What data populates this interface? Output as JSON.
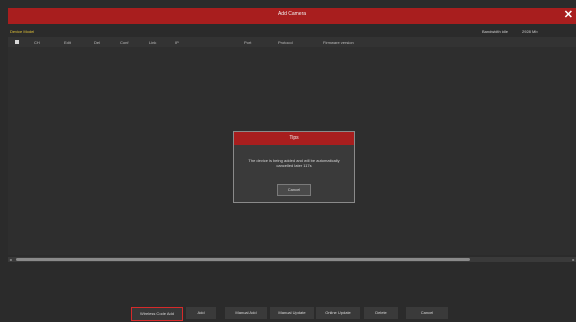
{
  "window": {
    "title": "Add Camera",
    "close_glyph": "✕"
  },
  "device_row": {
    "left_label": "Device Model",
    "bandwidth_label": "Bandwidth idle",
    "bandwidth_value": "2928 Mb"
  },
  "table": {
    "columns": [
      "CH",
      "Edit",
      "Del",
      "Conf",
      "Link",
      "IP",
      "Port",
      "Protocol",
      "Firmware version"
    ]
  },
  "dialog": {
    "title": "Tips",
    "message": "The device is being added and will be automatically cancelled later 117s",
    "button": "Cancel"
  },
  "footer": {
    "buttons": [
      {
        "label": "Wireless Code Add",
        "highlighted": true
      },
      {
        "label": "Add"
      },
      {
        "label": "Manual Add"
      },
      {
        "label": "Manual Update"
      },
      {
        "label": "Online Update"
      },
      {
        "label": "Delete"
      },
      {
        "label": "Cancel"
      }
    ]
  },
  "colors": {
    "title_bar": "#a81e1e",
    "highlight_border": "#d62a2a",
    "device_label": "#e0c238",
    "background": "#2b2b2b"
  }
}
